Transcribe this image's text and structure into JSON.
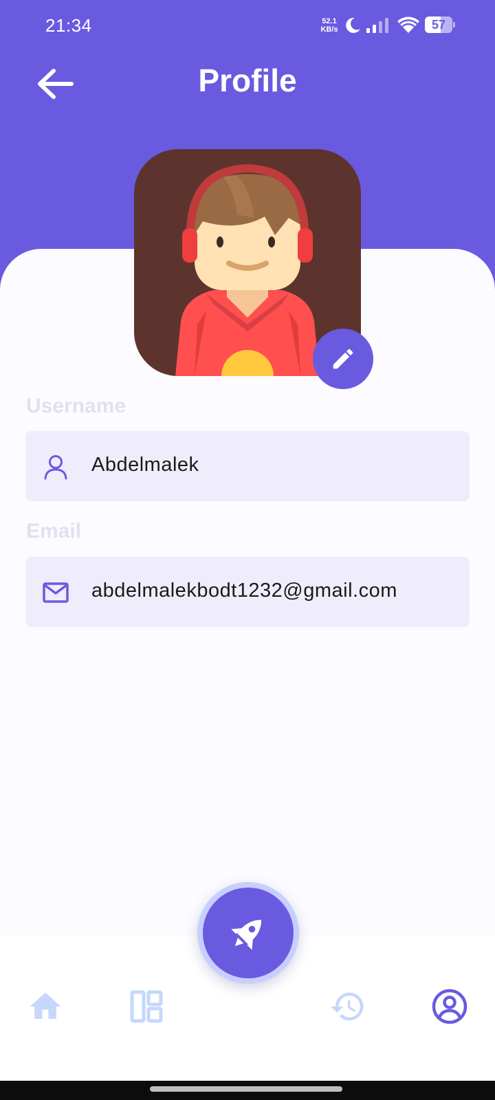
{
  "status_bar": {
    "time": "21:34",
    "net_speed_value": "52.1",
    "net_speed_unit": "KB/s",
    "battery_level": "57",
    "icons": [
      "moon-icon",
      "signal-icon",
      "wifi-icon",
      "battery-icon"
    ]
  },
  "header": {
    "title": "Profile",
    "back_icon": "arrow-left-icon"
  },
  "profile": {
    "avatar": "avatar-illustration",
    "edit_icon": "pencil-icon"
  },
  "form": {
    "username": {
      "label": "Username",
      "value": "Abdelmalek",
      "icon": "user-icon"
    },
    "email": {
      "label": "Email",
      "value": "abdelmalekbodt1232@gmail.com",
      "icon": "mail-icon"
    }
  },
  "bottom_nav": {
    "items": [
      {
        "icon": "home-icon",
        "active": false
      },
      {
        "icon": "dashboard-icon",
        "active": false
      },
      {
        "icon": "rocket-icon",
        "active": true
      },
      {
        "icon": "history-icon",
        "active": false
      },
      {
        "icon": "account-icon",
        "active": true
      }
    ]
  },
  "colors": {
    "primary": "#6a5ae0",
    "field_bg": "#efedfb",
    "label": "#e2e0ee",
    "inactive_nav": "#c5d7fb",
    "fab_ring": "#c7cfff"
  }
}
